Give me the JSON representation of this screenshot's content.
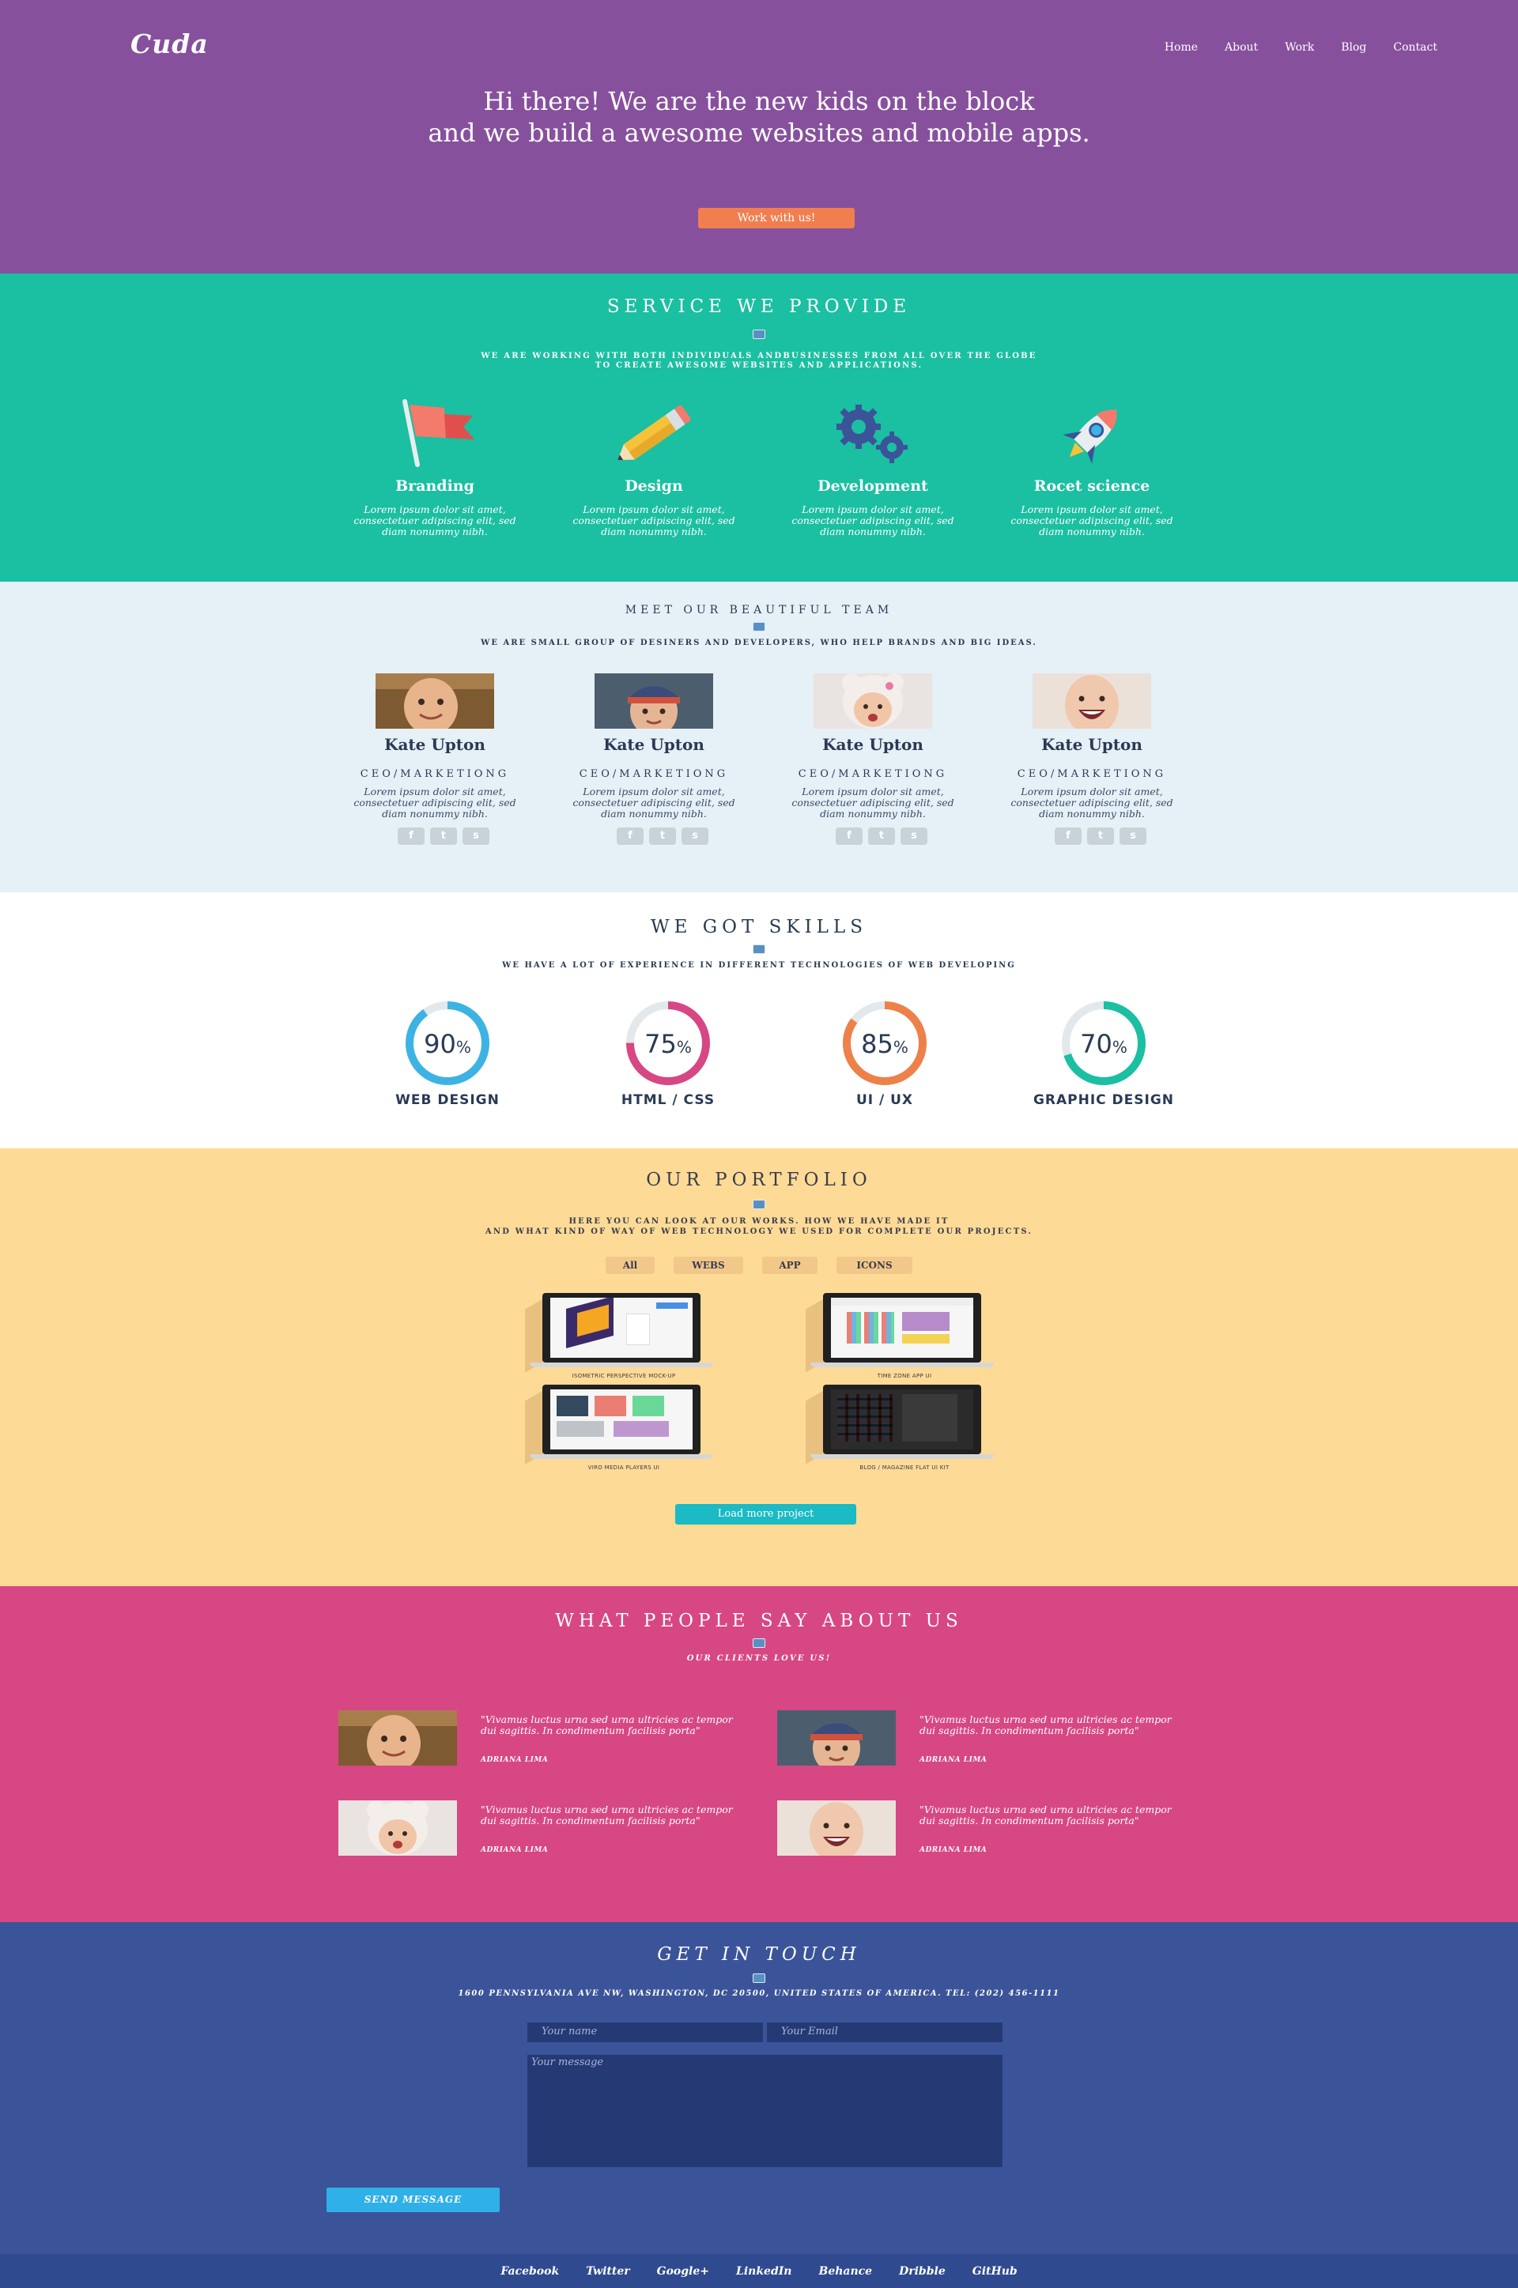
{
  "colors": {
    "hero_bg": "#87509d",
    "cta": "#f07e4e",
    "services_bg": "#1bbfa1",
    "team_bg": "#e6f0f7",
    "skills_bg": "#ffffff",
    "portfolio_bg": "#fddb96",
    "testimonials_bg": "#d74783",
    "contact_bg": "#3b5499",
    "footer_bg": "#2f4a8e",
    "skill_web": "#3db3e3",
    "skill_html": "#d74783",
    "skill_ux": "#ed8149",
    "skill_graphic": "#1bbfa1"
  },
  "header": {
    "logo": "Cuda",
    "nav": [
      "Home",
      "About",
      "Work",
      "Blog",
      "Contact"
    ]
  },
  "hero": {
    "line1": "Hi there! We are the new kids on the block",
    "line2": "and we build a awesome websites and mobile apps.",
    "cta": "Work with us!"
  },
  "services": {
    "title": "SERVICE WE PROVIDE",
    "subtitle_line1": "WE ARE WORKING WITH BOTH INDIVIDUALS ANDBUSINESSES FROM ALL OVER THE GLOBE",
    "subtitle_line2": "TO CREATE AWESOME WEBSITES AND APPLICATIONS.",
    "items": [
      {
        "icon": "flag-icon",
        "name": "Branding",
        "desc": "Lorem ipsum dolor sit amet, consectetuer adipiscing elit, sed diam nonummy nibh."
      },
      {
        "icon": "pencil-icon",
        "name": "Design",
        "desc": "Lorem ipsum dolor sit amet, consectetuer adipiscing elit, sed diam nonummy nibh."
      },
      {
        "icon": "gears-icon",
        "name": "Development",
        "desc": "Lorem ipsum dolor sit amet, consectetuer adipiscing elit, sed diam nonummy nibh."
      },
      {
        "icon": "rocket-icon",
        "name": "Rocet science",
        "desc": "Lorem ipsum dolor sit amet, consectetuer adipiscing elit, sed diam nonummy nibh."
      }
    ]
  },
  "team": {
    "title": "MEET OUR BEAUTIFUL TEAM",
    "subtitle": "WE ARE SMALL GROUP OF DESINERS AND DEVELOPERS, WHO HELP BRANDS AND BIG IDEAS.",
    "members": [
      {
        "name": "Kate Upton",
        "role": "CEO/MARKETIONG",
        "desc": "Lorem ipsum dolor sit amet, consectetuer adipiscing elit, sed diam nonummy nibh."
      },
      {
        "name": "Kate Upton",
        "role": "CEO/MARKETIONG",
        "desc": "Lorem ipsum dolor sit amet, consectetuer adipiscing elit, sed diam nonummy nibh."
      },
      {
        "name": "Kate Upton",
        "role": "CEO/MARKETIONG",
        "desc": "Lorem ipsum dolor sit amet, consectetuer adipiscing elit, sed diam nonummy nibh."
      },
      {
        "name": "Kate Upton",
        "role": "CEO/MARKETIONG",
        "desc": "Lorem ipsum dolor sit amet, consectetuer adipiscing elit, sed diam nonummy nibh."
      }
    ],
    "social_icons": [
      "facebook-icon",
      "twitter-icon",
      "skype-icon"
    ]
  },
  "skills": {
    "title": "WE GOT SKILLS",
    "subtitle": "WE HAVE A LOT OF EXPERIENCE IN DIFFERENT TECHNOLOGIES OF WEB DEVELOPING",
    "items": [
      {
        "value": 90,
        "percent_sign": "%",
        "label": "WEB DESIGN"
      },
      {
        "value": 75,
        "percent_sign": "%",
        "label": "HTML / CSS"
      },
      {
        "value": 85,
        "percent_sign": "%",
        "label": "UI / UX"
      },
      {
        "value": 70,
        "percent_sign": "%",
        "label": "GRAPHIC DESIGN"
      }
    ]
  },
  "portfolio": {
    "title": "OUR PORTFOLIO",
    "subtitle_line1": "HERE YOU CAN LOOK AT OUR WORKS. HOW WE HAVE MADE IT",
    "subtitle_line2": "AND WHAT KIND OF WAY OF WEB TECHNOLOGY WE USED FOR COMPLETE OUR PROJECTS.",
    "filters": [
      "All",
      "WEBS",
      "APP",
      "ICONS"
    ],
    "items": [
      {
        "caption": "ISOMETRIC PERSPECTIVE MOCK-UP"
      },
      {
        "caption": "TIME ZONE APP UI"
      },
      {
        "caption": "VIRO MEDIA PLAYERS UI"
      },
      {
        "caption": "BLOG / MAGAZINE FLAT UI KIT"
      }
    ],
    "load_more": "Load more project"
  },
  "testimonials": {
    "title": "WHAT PEOPLE SAY ABOUT US",
    "subtitle": "OUR CLIENTS LOVE US!",
    "quotes": [
      {
        "text": "\"Vivamus luctus urna sed urna ultricies ac tempor dui sagittis. In condimentum facilisis porta\"",
        "author": "ADRIANA LIMA"
      },
      {
        "text": "\"Vivamus luctus urna sed urna ultricies ac tempor dui sagittis. In condimentum facilisis porta\"",
        "author": "ADRIANA LIMA"
      },
      {
        "text": "\"Vivamus luctus urna sed urna ultricies ac tempor dui sagittis. In condimentum facilisis porta\"",
        "author": "ADRIANA LIMA"
      },
      {
        "text": "\"Vivamus luctus urna sed urna ultricies ac tempor dui sagittis. In condimentum facilisis porta\"",
        "author": "ADRIANA LIMA"
      }
    ]
  },
  "contact": {
    "title": "GET IN TOUCH",
    "address": "1600 PENNSYLVANIA AVE NW, WASHINGTON, DC 20500, UNITED STATES OF AMERICA. TEL: (202) 456-1111",
    "name_placeholder": "Your name",
    "email_placeholder": "Your Email",
    "message_placeholder": "Your message",
    "send": "SEND MESSAGE"
  },
  "footer": {
    "links": [
      "Facebook",
      "Twitter",
      "Google+",
      "LinkedIn",
      "Behance",
      "Dribble",
      "GitHub"
    ]
  }
}
